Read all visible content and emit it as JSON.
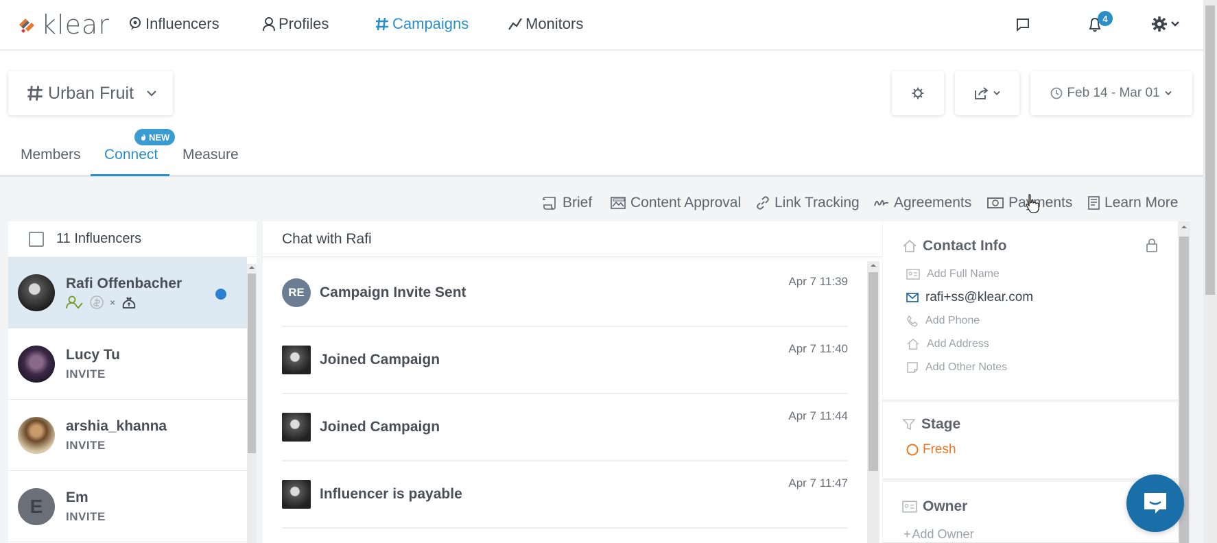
{
  "brand": {
    "logo_text": "klear"
  },
  "nav": {
    "items": [
      {
        "label": "Influencers",
        "icon": "influencer-pin-icon"
      },
      {
        "label": "Profiles",
        "icon": "person-icon"
      },
      {
        "label": "Campaigns",
        "icon": "hashtag-icon",
        "active": true
      },
      {
        "label": "Monitors",
        "icon": "trend-line-icon"
      }
    ],
    "notification_count": "4"
  },
  "campaign": {
    "name": "Urban Fruit"
  },
  "date_range": "Feb 14 - Mar 01",
  "subtabs": [
    {
      "label": "Members"
    },
    {
      "label": "Connect",
      "active": true
    },
    {
      "label": "Measure"
    }
  ],
  "new_badge": "NEW",
  "toolbar": {
    "brief": "Brief",
    "content_approval": "Content Approval",
    "link_tracking": "Link Tracking",
    "agreements": "Agreements",
    "payments": "Payments",
    "learn_more": "Learn More"
  },
  "influencers": {
    "header": "11 Influencers",
    "rows": [
      {
        "name": "Rafi Offenbacher",
        "status": "",
        "selected": true
      },
      {
        "name": "Lucy Tu",
        "status": "INVITE"
      },
      {
        "name": "arshia_khanna",
        "status": "INVITE"
      },
      {
        "name": "Em",
        "status": "INVITE",
        "initial": "E"
      }
    ]
  },
  "chat": {
    "title": "Chat with Rafi",
    "events": [
      {
        "initials": "RE",
        "title": "Campaign Invite Sent",
        "time": "Apr 7 11:39"
      },
      {
        "title": "Joined Campaign",
        "time": "Apr 7 11:40"
      },
      {
        "title": "Joined Campaign",
        "time": "Apr 7 11:44"
      },
      {
        "title": "Influencer is payable",
        "time": "Apr 7 11:47"
      }
    ]
  },
  "contact": {
    "title": "Contact Info",
    "add_full_name": "Add Full Name",
    "email": "rafi+ss@klear.com",
    "add_phone": "Add Phone",
    "add_address": "Add Address",
    "add_other_notes": "Add Other Notes"
  },
  "stage": {
    "title": "Stage",
    "value": "Fresh"
  },
  "owner": {
    "title": "Owner",
    "add_owner": "Add Owner"
  },
  "colors": {
    "accent": "#2b8fc7",
    "stage_fresh": "#e87722",
    "selected_row": "#dde9f3",
    "fab": "#1a6fa8"
  }
}
